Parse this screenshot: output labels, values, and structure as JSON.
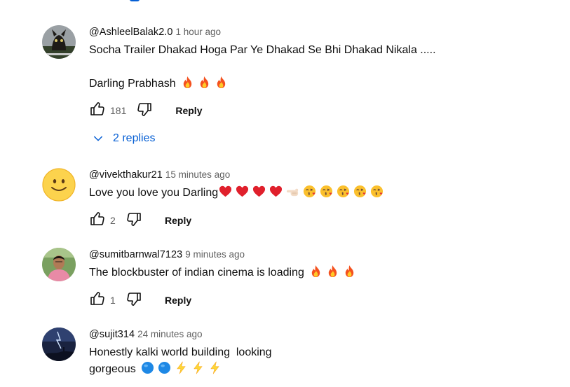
{
  "comments": [
    {
      "author": "@AshleelBalak2.0",
      "time": "1 hour ago",
      "lines": [
        "Socha Trailer Dhakad Hoga Par Ye Dhakad Se Bhi Dhakad Nikala .....",
        "Darling Prabhash"
      ],
      "emojis": [
        "fire",
        "fire",
        "fire"
      ],
      "likes": "181",
      "reply_label": "Reply",
      "replies_label": "2 replies"
    },
    {
      "author": "@vivekthakur21",
      "time": "15 minutes ago",
      "lines": [
        "Love you love you Darling"
      ],
      "emojis": [
        "red-heart",
        "red-heart",
        "red-heart",
        "red-heart",
        "pointing-hand",
        "kissing-face",
        "kissing-face",
        "kissing-face",
        "kissing-face",
        "kissing-face"
      ],
      "likes": "2",
      "reply_label": "Reply"
    },
    {
      "author": "@sumitbarnwal7123",
      "time": "9 minutes ago",
      "lines": [
        "The blockbuster of indian cinema is loading"
      ],
      "emojis": [
        "fire",
        "fire",
        "fire"
      ],
      "likes": "1",
      "reply_label": "Reply"
    },
    {
      "author": "@sujit314",
      "time": "24 minutes ago",
      "lines": [
        "Honestly kalki world building  looking",
        "gorgeous"
      ],
      "emojis": [
        "blue-circle",
        "blue-circle",
        "lightning",
        "lightning",
        "lightning"
      ]
    }
  ],
  "colors": {
    "text": "#0f0f0f",
    "secondary": "#606060",
    "link_blue": "#065fd4"
  }
}
